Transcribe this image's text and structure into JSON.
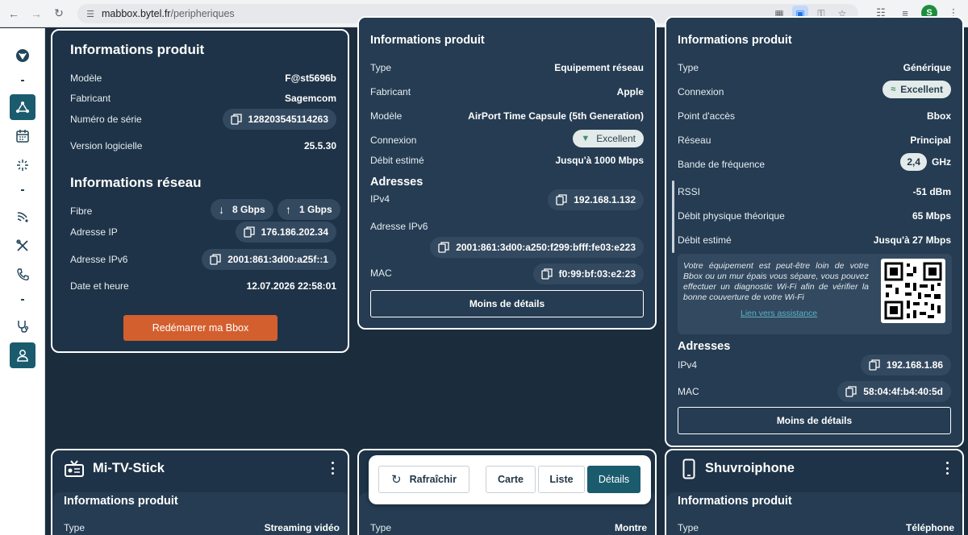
{
  "browser": {
    "url_domain": "mabbox.bytel.fr",
    "url_path": "/peripheriques",
    "profile_initial": "S"
  },
  "bbox_card": {
    "product_title": "Informations produit",
    "rows": [
      {
        "label": "Modèle",
        "value": "F@st5696b"
      },
      {
        "label": "Fabricant",
        "value": "Sagemcom"
      },
      {
        "label": "Numéro de série",
        "value": "128203545114263"
      },
      {
        "label": "Version logicielle",
        "value": "25.5.30"
      }
    ],
    "network_title": "Informations réseau",
    "fibre_label": "Fibre",
    "fibre_down": "8 Gbps",
    "fibre_up": "1 Gbps",
    "ip_label": "Adresse IP",
    "ip_value": "176.186.202.34",
    "ipv6_label": "Adresse IPv6",
    "ipv6_value": "2001:861:3d00:a25f::1",
    "date_label": "Date et heure",
    "date_value": "12.07.2026 22:58:01",
    "restart_button": "Redémarrer ma Bbox"
  },
  "apple_card": {
    "product_title": "Informations produit",
    "rows": [
      {
        "label": "Type",
        "value": "Equipement réseau"
      },
      {
        "label": "Fabricant",
        "value": "Apple"
      },
      {
        "label": "Modèle",
        "value": "AirPort Time Capsule (5th Generation)"
      }
    ],
    "connexion_label": "Connexion",
    "connexion_value": "Excellent",
    "debit_label": "Débit estimé",
    "debit_value": "Jusqu'à 1000 Mbps",
    "addresses_title": "Adresses",
    "ipv4_label": "IPv4",
    "ipv4_value": "192.168.1.132",
    "ipv6_label": "Adresse IPv6",
    "ipv6_value": "2001:861:3d00:a250:f299:bfff:fe03:e223",
    "mac_label": "MAC",
    "mac_value": "f0:99:bf:03:e2:23",
    "less_button": "Moins de détails"
  },
  "generic_card": {
    "product_title": "Informations produit",
    "type_label": "Type",
    "type_value": "Générique",
    "connexion_label": "Connexion",
    "connexion_value": "Excellent",
    "ap_label": "Point d'accès",
    "ap_value": "Bbox",
    "reseau_label": "Réseau",
    "reseau_value": "Principal",
    "band_label": "Bande de fréquence",
    "band_value": "2,4",
    "band_unit": "GHz",
    "rssi_label": "RSSI",
    "rssi_value": "-51 dBm",
    "phy_label": "Débit physique théorique",
    "phy_value": "65 Mbps",
    "debit_label": "Débit estimé",
    "debit_value": "Jusqu'à 27 Mbps",
    "info_text": "Votre équipement est peut-être loin de votre Bbox ou un mur épais vous sépare, vous pouvez effectuer un diagnostic Wi-Fi afin de vérifier la bonne couverture de votre Wi-Fi",
    "info_link": "Lien vers assistance",
    "addresses_title": "Adresses",
    "ipv4_label": "IPv4",
    "ipv4_value": "192.168.1.86",
    "mac_label": "MAC",
    "mac_value": "58:04:4f:b4:40:5d",
    "less_button": "Moins de détails"
  },
  "tv_card": {
    "name": "Mi-TV-Stick",
    "product_title": "Informations produit",
    "type_label": "Type",
    "type_value": "Streaming vidéo"
  },
  "watch_card": {
    "type_label": "Type",
    "type_value": "Montre"
  },
  "phone_card": {
    "name": "Shuvroiphone",
    "product_title": "Informations produit",
    "type_label": "Type",
    "type_value": "Téléphone"
  },
  "view_switcher": {
    "refresh": "Rafraîchir",
    "map": "Carte",
    "list": "Liste",
    "details": "Détails"
  },
  "colors": {
    "accent": "#1b5b6e",
    "orange": "#d35f2e",
    "card_bg": "#1e3347"
  }
}
